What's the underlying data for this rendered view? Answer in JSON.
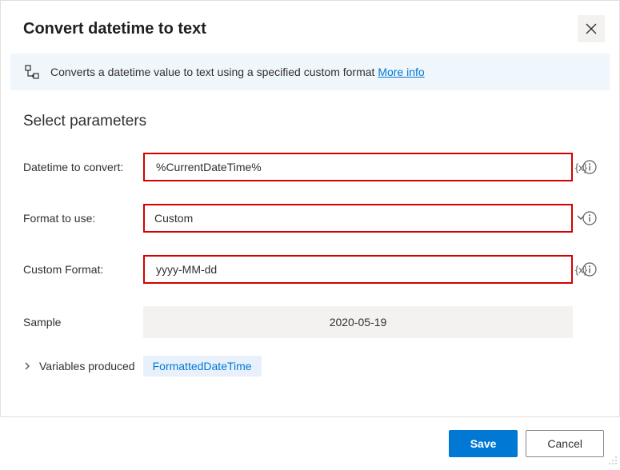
{
  "header": {
    "title": "Convert datetime to text"
  },
  "info": {
    "text": "Converts a datetime value to text using a specified custom format ",
    "more": "More info"
  },
  "section": {
    "title": "Select parameters"
  },
  "fields": {
    "datetime": {
      "label": "Datetime to convert:",
      "value": "%CurrentDateTime%",
      "suffix": "{x}"
    },
    "format": {
      "label": "Format to use:",
      "value": "Custom"
    },
    "custom": {
      "label": "Custom Format:",
      "value": "yyyy-MM-dd",
      "suffix": "{x}"
    },
    "sample": {
      "label": "Sample",
      "value": "2020-05-19"
    }
  },
  "vars": {
    "label": "Variables produced",
    "chip": "FormattedDateTime"
  },
  "buttons": {
    "save": "Save",
    "cancel": "Cancel"
  }
}
